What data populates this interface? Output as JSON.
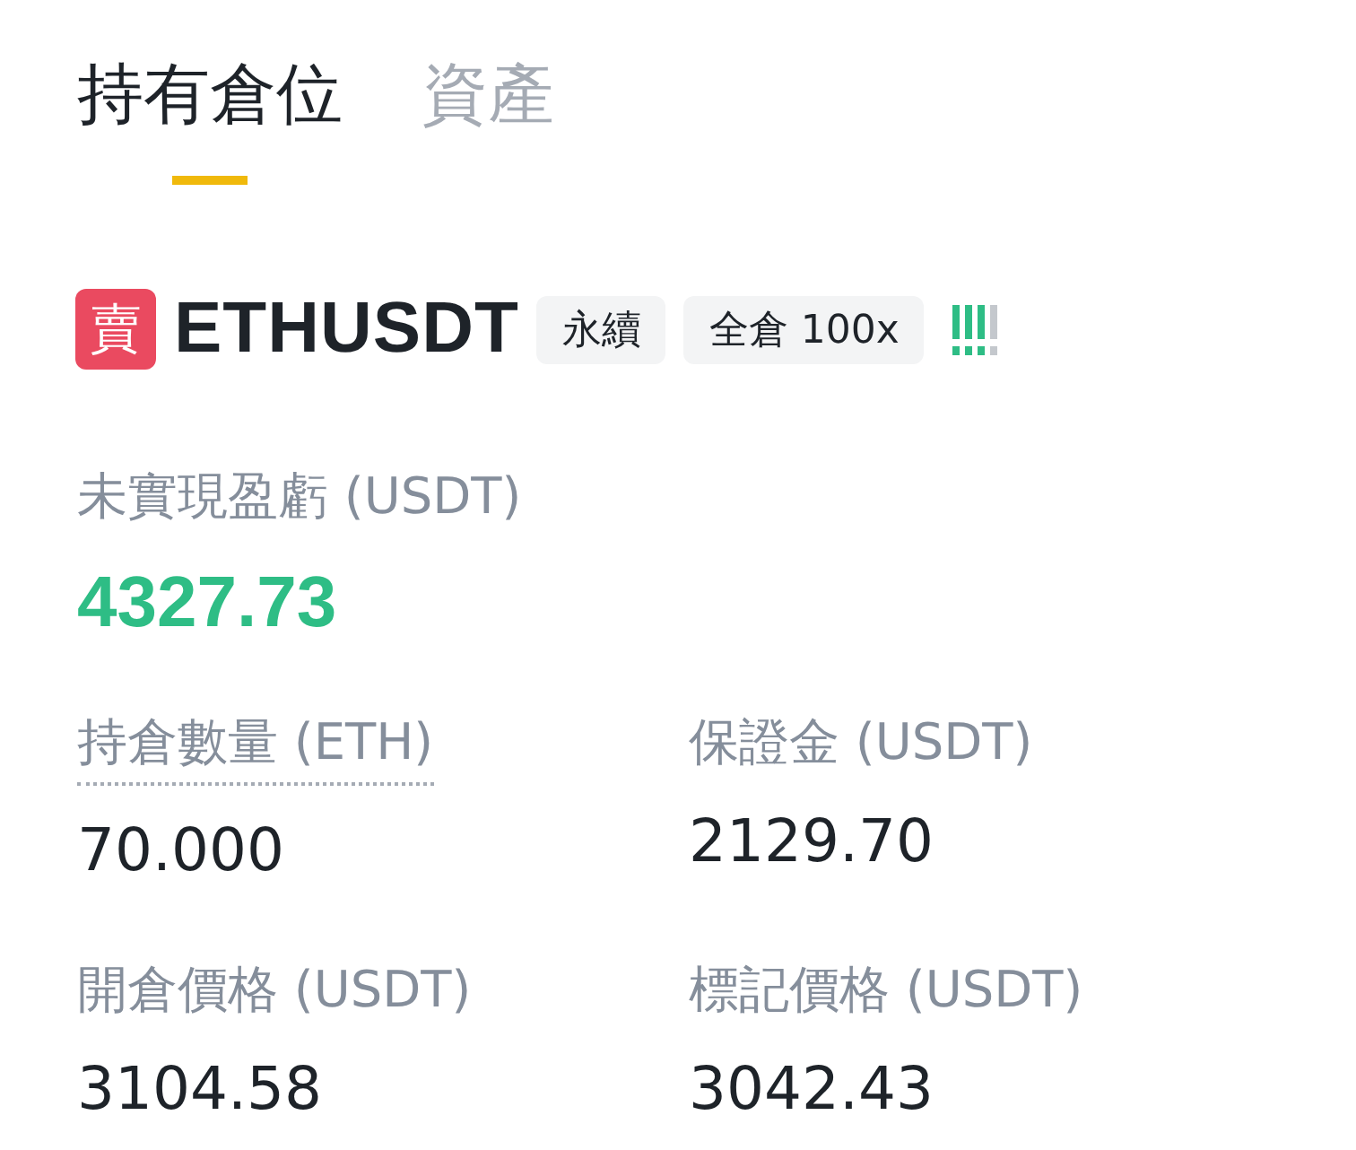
{
  "tabs": [
    {
      "label": "持有倉位",
      "selected": true
    },
    {
      "label": "資產",
      "selected": false
    }
  ],
  "position": {
    "side": "賣",
    "symbol": "ETHUSDT",
    "tags": [
      "永續",
      "全倉 100x"
    ],
    "risk": {
      "level": 0.75
    }
  },
  "pnl": {
    "label": "未實現盈虧 (USDT)",
    "value": "4327.73"
  },
  "fields": [
    {
      "label": "持倉數量 (ETH)",
      "value": "70.000",
      "dotted": true
    },
    {
      "label": "保證金 (USDT)",
      "value": "2129.70",
      "dotted": false
    },
    {
      "label": "開倉價格 (USDT)",
      "value": "3104.58",
      "dotted": false
    },
    {
      "label": "標記價格 (USDT)",
      "value": "3042.43",
      "dotted": false
    }
  ]
}
